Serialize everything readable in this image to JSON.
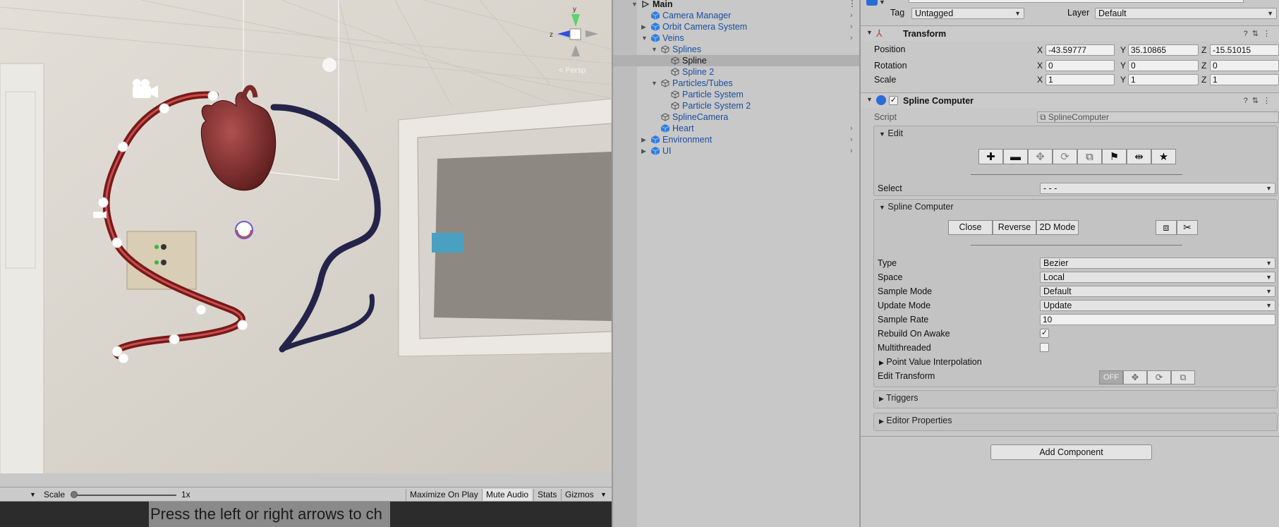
{
  "scene": {
    "persp_label": "< Persp",
    "axis_labels": {
      "y": "y",
      "z": "z"
    }
  },
  "game_toolbar": {
    "scale_label": "Scale",
    "scale_value": "1x",
    "maximize_label": "Maximize On Play",
    "mute_label": "Mute Audio",
    "stats_label": "Stats",
    "gizmos_label": "Gizmos",
    "scale_slider_fraction": 0.0
  },
  "game_view": {
    "caption": "Press the left or right arrows to ch"
  },
  "hierarchy": {
    "items": [
      {
        "label": "Main",
        "depth": 0,
        "type": "scene",
        "expanded": true,
        "bold": true
      },
      {
        "label": "Camera Manager",
        "depth": 1,
        "type": "prefab",
        "expanded": null,
        "chevron": true
      },
      {
        "label": "Orbit Camera System",
        "depth": 1,
        "type": "prefab",
        "expanded": false,
        "chevron": true
      },
      {
        "label": "Veins",
        "depth": 1,
        "type": "prefab",
        "expanded": true,
        "chevron": true
      },
      {
        "label": "Splines",
        "depth": 2,
        "type": "object",
        "expanded": true
      },
      {
        "label": "Spline",
        "depth": 3,
        "type": "object",
        "selected": true
      },
      {
        "label": "Spline 2",
        "depth": 3,
        "type": "object"
      },
      {
        "label": "Particles/Tubes",
        "depth": 2,
        "type": "object",
        "expanded": true
      },
      {
        "label": "Particle System",
        "depth": 3,
        "type": "object"
      },
      {
        "label": "Particle System 2",
        "depth": 3,
        "type": "object"
      },
      {
        "label": "SplineCamera",
        "depth": 2,
        "type": "object"
      },
      {
        "label": "Heart",
        "depth": 2,
        "type": "prefab",
        "chevron": true
      },
      {
        "label": "Environment",
        "depth": 1,
        "type": "prefab",
        "expanded": false,
        "chevron": true
      },
      {
        "label": "UI",
        "depth": 1,
        "type": "prefab",
        "expanded": false,
        "chevron": true
      }
    ]
  },
  "inspector": {
    "tag_label": "Tag",
    "tag_value": "Untagged",
    "layer_label": "Layer",
    "layer_value": "Default",
    "transform": {
      "title": "Transform",
      "position_label": "Position",
      "rotation_label": "Rotation",
      "scale_label": "Scale",
      "position": {
        "x": "-43.59777",
        "y": "35.10865",
        "z": "-15.51015"
      },
      "rotation": {
        "x": "0",
        "y": "0",
        "z": "0"
      },
      "scale": {
        "x": "1",
        "y": "1",
        "z": "1"
      },
      "axis_x": "X",
      "axis_y": "Y",
      "axis_z": "Z"
    },
    "spline_computer": {
      "title": "Spline Computer",
      "script_label": "Script",
      "script_value": "SplineComputer",
      "edit_section": "Edit",
      "select_label": "Select",
      "select_value": "- - -",
      "sub_section": "Spline Computer",
      "close_btn": "Close",
      "reverse_btn": "Reverse",
      "mode2d_btn": "2D Mode",
      "type_label": "Type",
      "type_value": "Bezier",
      "space_label": "Space",
      "space_value": "Local",
      "sample_mode_label": "Sample Mode",
      "sample_mode_value": "Default",
      "update_mode_label": "Update Mode",
      "update_mode_value": "Update",
      "sample_rate_label": "Sample Rate",
      "sample_rate_value": "10",
      "rebuild_label": "Rebuild On Awake",
      "rebuild_checked": true,
      "multithreaded_label": "Multithreaded",
      "multithreaded_checked": false,
      "point_value_label": "Point Value Interpolation",
      "edit_transform_label": "Edit Transform",
      "edit_transform_off": "OFF",
      "triggers_label": "Triggers",
      "editor_props_label": "Editor Properties"
    },
    "add_component": "Add Component"
  }
}
